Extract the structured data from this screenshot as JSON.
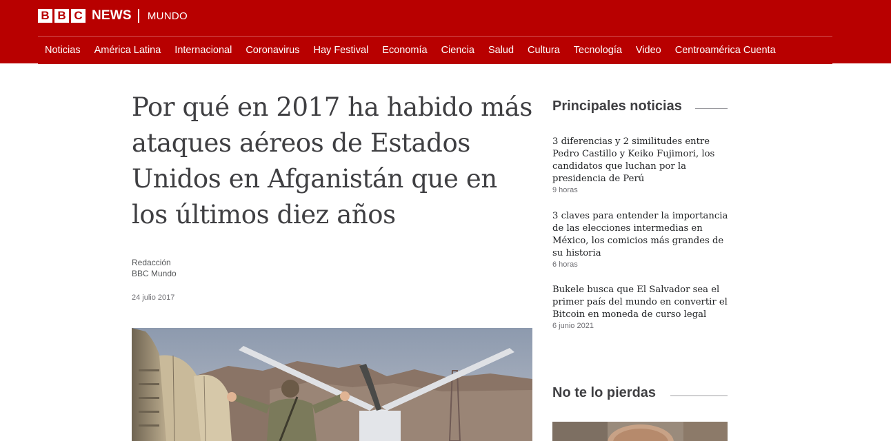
{
  "brand": {
    "blocks": [
      "B",
      "B",
      "C"
    ],
    "news": "NEWS",
    "section": "MUNDO",
    "colors": {
      "brand_red": "#b80000",
      "text": "#3f3f42"
    }
  },
  "nav": {
    "items": [
      {
        "label": "Noticias"
      },
      {
        "label": "América Latina"
      },
      {
        "label": "Internacional"
      },
      {
        "label": "Coronavirus"
      },
      {
        "label": "Hay Festival"
      },
      {
        "label": "Economía"
      },
      {
        "label": "Ciencia"
      },
      {
        "label": "Salud"
      },
      {
        "label": "Cultura"
      },
      {
        "label": "Tecnología"
      },
      {
        "label": "Video"
      },
      {
        "label": "Centroamérica Cuenta"
      }
    ]
  },
  "article": {
    "headline": "Por qué en 2017 ha habido más ataques aéreos de Estados Unidos en Afganistán que en los últimos diez años",
    "author_role": "Redacción",
    "author_org": "BBC Mundo",
    "date": "24 julio 2017"
  },
  "sidebar": {
    "top_stories_title": "Principales noticias",
    "stories": [
      {
        "title": "3 diferencias y 2 similitudes entre Pedro Castillo y Keiko Fujimori, los candidatos que luchan por la presidencia de Perú",
        "time": "9 horas"
      },
      {
        "title": "3 claves para entender la importancia de las elecciones intermedias en México, los comicios más grandes de su historia",
        "time": "6 horas"
      },
      {
        "title": "Bukele busca que El Salvador sea el primer país del mundo en convertir el Bitcoin en moneda de curso legal",
        "time": "6 junio 2021"
      }
    ],
    "dont_miss_title": "No te lo pierdas"
  }
}
